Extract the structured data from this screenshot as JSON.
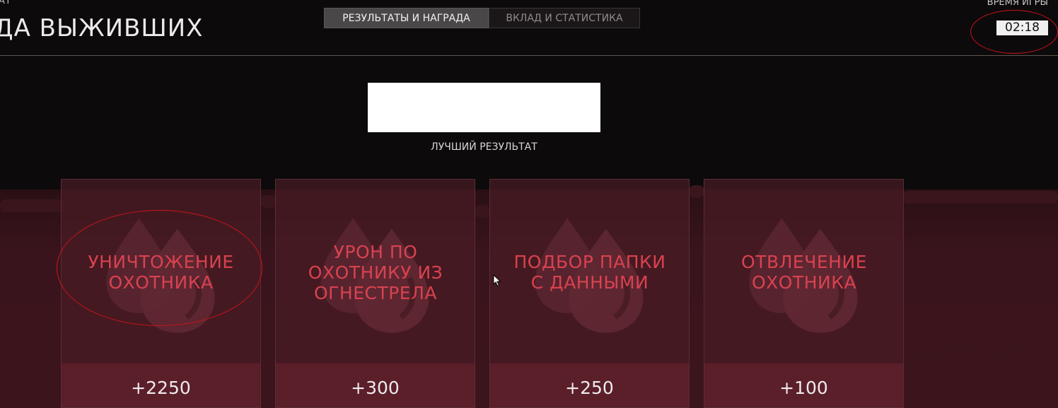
{
  "header": {
    "mode_label": "АТ",
    "title": "ДА ВЫЖИВШИХ",
    "tabs": [
      {
        "label": "РЕЗУЛЬТАТЫ И НАГРАДА",
        "active": true
      },
      {
        "label": "ВКЛАД И СТАТИСТИКА",
        "active": false
      }
    ],
    "time_label": "ВРЕМЯ ИГРЫ",
    "time_value": "02:18"
  },
  "best": {
    "label": "ЛУЧШИЙ РЕЗУЛЬТАТ"
  },
  "cards": [
    {
      "title": "УНИЧТОЖЕНИЕ ОХОТНИКА",
      "value": "+2250",
      "icon": "blood-drop-icon"
    },
    {
      "title": "УРОН ПО ОХОТНИКУ ИЗ ОГНЕСТРЕЛА",
      "value": "+300",
      "icon": "blood-drop-icon"
    },
    {
      "title": "ПОДБОР ПАПКИ С ДАННЫМИ",
      "value": "+250",
      "icon": "blood-drop-icon"
    },
    {
      "title": "ОТВЛЕЧЕНИЕ ОХОТНИКА",
      "value": "+100",
      "icon": "blood-drop-icon"
    }
  ],
  "colors": {
    "accent_red": "#d9424f",
    "annotation_red": "#c8141a",
    "card_bg": "#4a1c24",
    "card_footer": "#5b1f29"
  }
}
